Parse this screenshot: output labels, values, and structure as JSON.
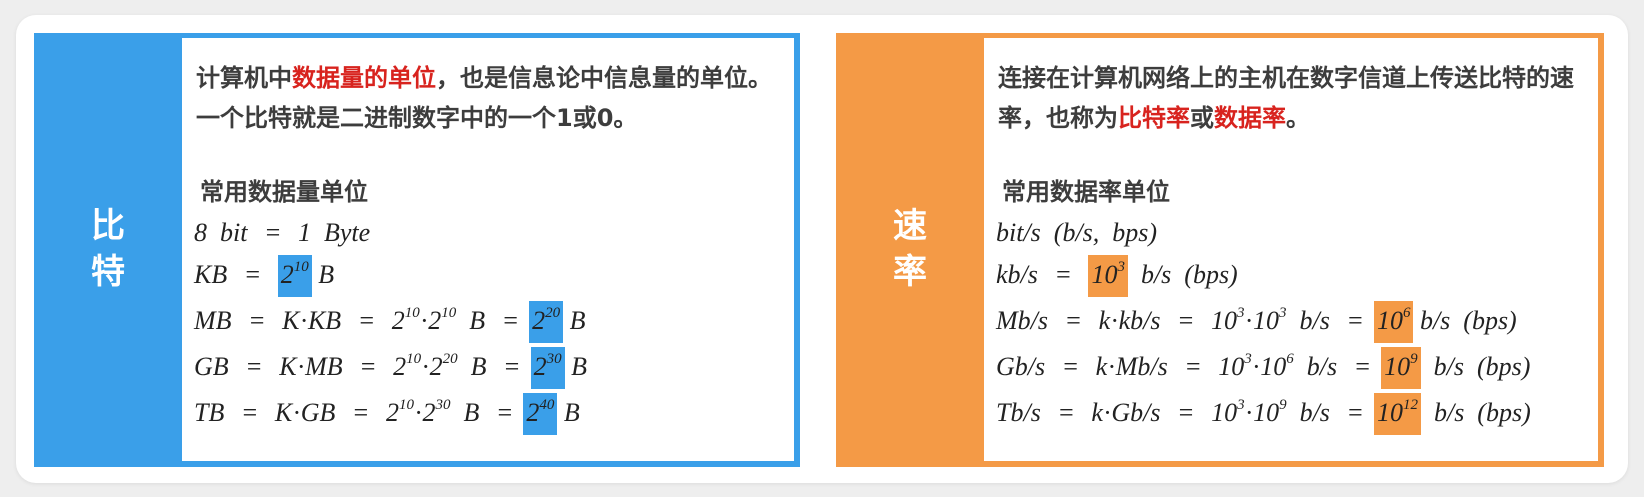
{
  "bit_card": {
    "side_label": [
      "比",
      "特"
    ],
    "intro": {
      "pre": "计算机中",
      "highlight": "数据量的单位",
      "post": "，也是信息论中信息量的单位。一个比特就是二进制数字中的一个1或0。"
    },
    "subheading": "常用数据量单位",
    "formula_text": [
      "8 bit = 1 Byte",
      "KB = 2^10 B",
      "MB = K·KB = 2^10·2^10 B = 2^20 B",
      "GB = K·MB = 2^10·2^20 B = 2^30 B",
      "TB = K·GB = 2^10·2^30 B = 2^40 B"
    ]
  },
  "rate_card": {
    "side_label": [
      "速",
      "率"
    ],
    "intro": {
      "pre": "连接在计算机网络上的主机在数字信道上传送比特的速率，也称为",
      "highlight1": "比特率",
      "mid": "或",
      "highlight2": "数据率",
      "post": "。"
    },
    "subheading": "常用数据率单位",
    "formula_text": [
      "bit/s (b/s, bps)",
      "kb/s = 10^3 b/s (bps)",
      "Mb/s = k·kb/s = 10^3·10^3 b/s = 10^6 b/s (bps)",
      "Gb/s = k·Mb/s = 10^3·10^6 b/s = 10^9 b/s (bps)",
      "Tb/s = k·Gb/s = 10^3·10^9 b/s = 10^12 b/s (bps)"
    ]
  },
  "colors": {
    "bit_accent": "#3a9fe9",
    "rate_accent": "#f49a46",
    "highlight_text": "#d8231e"
  }
}
